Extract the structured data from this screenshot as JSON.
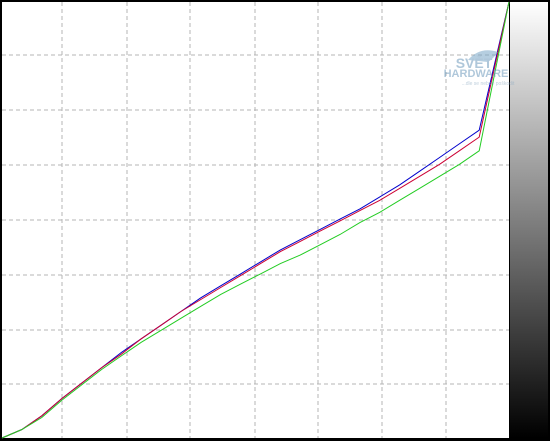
{
  "watermark": {
    "line1": "SVĚT",
    "line2": "HARDWARE",
    "tagline": "...dle se nebde poškodit"
  },
  "chart_data": {
    "type": "line",
    "title": "",
    "xlabel": "",
    "ylabel": "",
    "xlim": [
      0,
      255
    ],
    "ylim": [
      0,
      255
    ],
    "grid": true,
    "legend": "none",
    "colors": {
      "background": "#ffffff",
      "grid": "#b4b4b4",
      "frame": "#000000"
    },
    "gray_scale_bar": {
      "direction": "white-top-to-black-bottom"
    },
    "series": [
      {
        "color": "#0000cc",
        "x": [
          0,
          10,
          20,
          30,
          40,
          50,
          60,
          70,
          80,
          90,
          100,
          110,
          120,
          130,
          140,
          150,
          160,
          170,
          180,
          190,
          200,
          210,
          220,
          230,
          240,
          255
        ],
        "y": [
          0,
          5,
          13,
          23,
          32,
          41,
          50,
          58,
          66,
          74,
          82,
          89,
          96,
          103,
          110,
          116,
          122,
          128,
          134,
          141,
          148,
          156,
          164,
          172,
          180,
          255
        ]
      },
      {
        "color": "#cc0033",
        "x": [
          0,
          10,
          20,
          30,
          40,
          50,
          60,
          70,
          80,
          90,
          100,
          110,
          120,
          130,
          140,
          150,
          160,
          170,
          180,
          190,
          200,
          210,
          220,
          230,
          240,
          255
        ],
        "y": [
          0,
          5,
          13,
          23,
          32,
          41,
          49,
          58,
          66,
          74,
          81,
          88,
          95,
          102,
          109,
          115,
          121,
          127,
          133,
          139,
          146,
          153,
          160,
          168,
          176,
          255
        ]
      },
      {
        "color": "#22cc22",
        "x": [
          0,
          10,
          20,
          30,
          40,
          50,
          60,
          70,
          80,
          90,
          100,
          110,
          120,
          130,
          140,
          150,
          160,
          170,
          180,
          190,
          200,
          210,
          220,
          230,
          240,
          255
        ],
        "y": [
          0,
          5,
          12,
          22,
          31,
          40,
          48,
          56,
          63,
          70,
          77,
          84,
          90,
          96,
          102,
          107,
          113,
          119,
          126,
          132,
          139,
          146,
          153,
          160,
          168,
          255
        ]
      }
    ]
  }
}
